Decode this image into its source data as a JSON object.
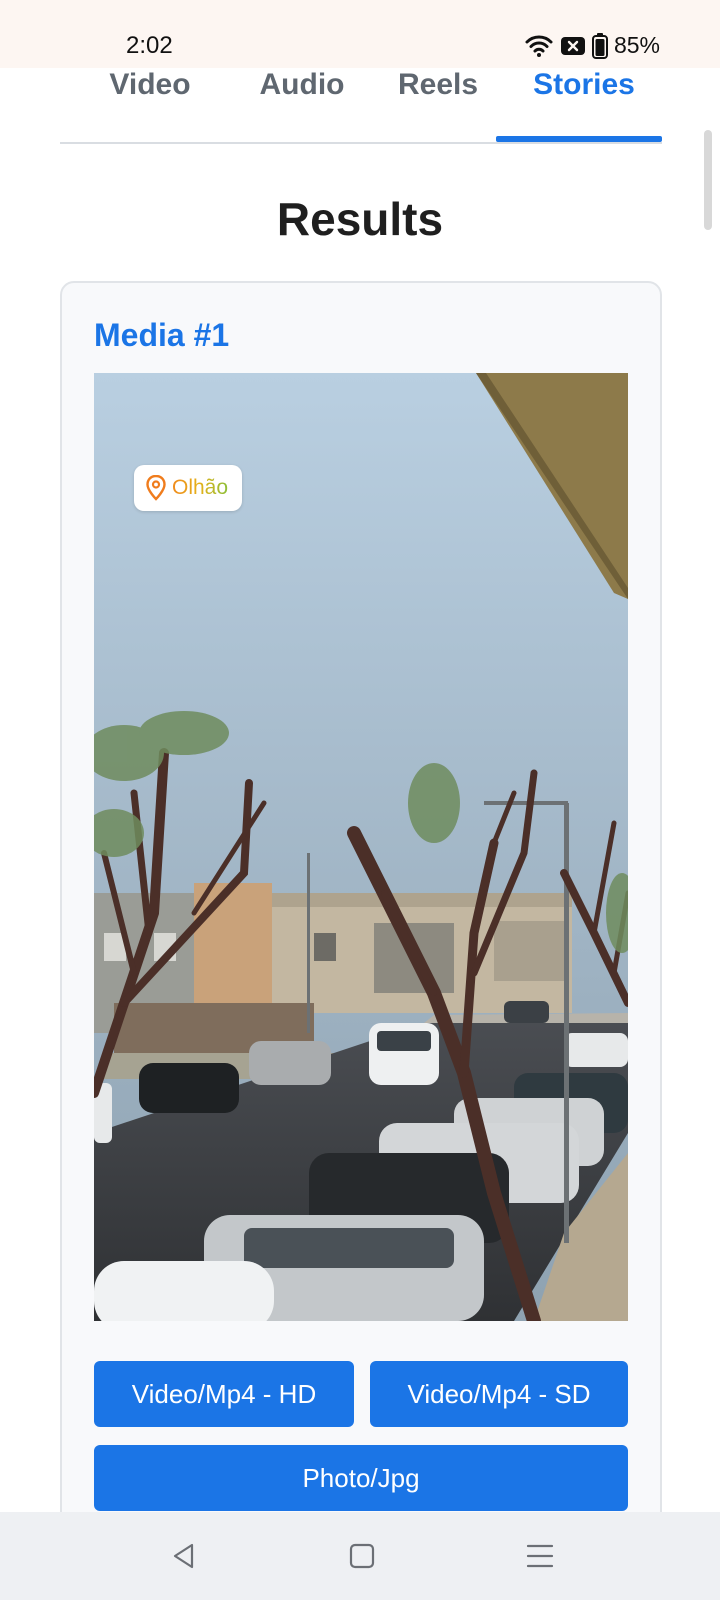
{
  "status": {
    "time": "2:02",
    "battery": "85%",
    "icons": [
      "wifi-icon",
      "notification-blocked-icon",
      "battery-icon"
    ]
  },
  "tabs": [
    {
      "label": "Video",
      "active": false
    },
    {
      "label": "Audio",
      "active": false
    },
    {
      "label": "Reels",
      "active": false
    },
    {
      "label": "Stories",
      "active": true
    }
  ],
  "results": {
    "title": "Results",
    "media": [
      {
        "title": "Media #1",
        "location_sticker": "Olhão",
        "buttons": {
          "video_hd": "Video/Mp4 - HD",
          "video_sd": "Video/Mp4 - SD",
          "photo_jpg": "Photo/Jpg"
        }
      }
    ]
  },
  "nav": {
    "icons": [
      "back-icon",
      "home-icon",
      "menu-icon"
    ]
  },
  "colors": {
    "accent": "#1b75e6",
    "tab_inactive": "#5f6770",
    "status_bar_bg": "#fdf6f2",
    "nav_bar_bg": "#eef0f3"
  }
}
